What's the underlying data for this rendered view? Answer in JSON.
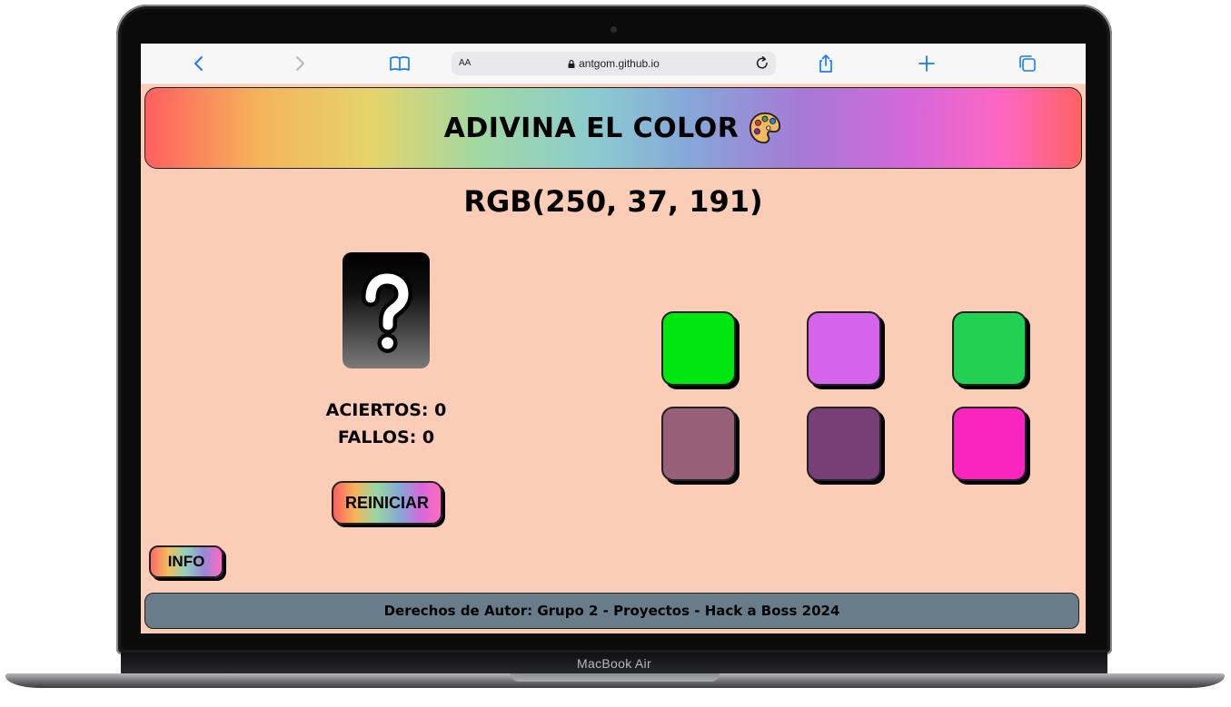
{
  "device": {
    "brand_label": "MacBook Air"
  },
  "browser": {
    "text_size_label": "AA",
    "url": "antgom.github.io",
    "icons": [
      "back-icon",
      "forward-icon",
      "bookmarks-icon",
      "lock-icon",
      "reload-icon",
      "share-icon",
      "new-tab-icon",
      "tabs-icon"
    ]
  },
  "game": {
    "title": "ADIVINA EL COLOR",
    "title_icon": "palette-icon",
    "target_color": "RGB(250, 37, 191)",
    "mystery_icon": "question-mark-icon",
    "score": {
      "hits_label": "ACIERTOS: 0",
      "misses_label": "FALLOS: 0"
    },
    "reset_label": "REINICIAR",
    "info_label": "INFO",
    "swatches": [
      {
        "color": "#00e70f"
      },
      {
        "color": "#d464ec"
      },
      {
        "color": "#20d152"
      },
      {
        "color": "#986078"
      },
      {
        "color": "#783e76"
      },
      {
        "color": "#fa25bf"
      }
    ]
  },
  "footer": {
    "text": "Derechos de Autor: Grupo 2 - Proyectos - Hack a Boss 2024"
  }
}
